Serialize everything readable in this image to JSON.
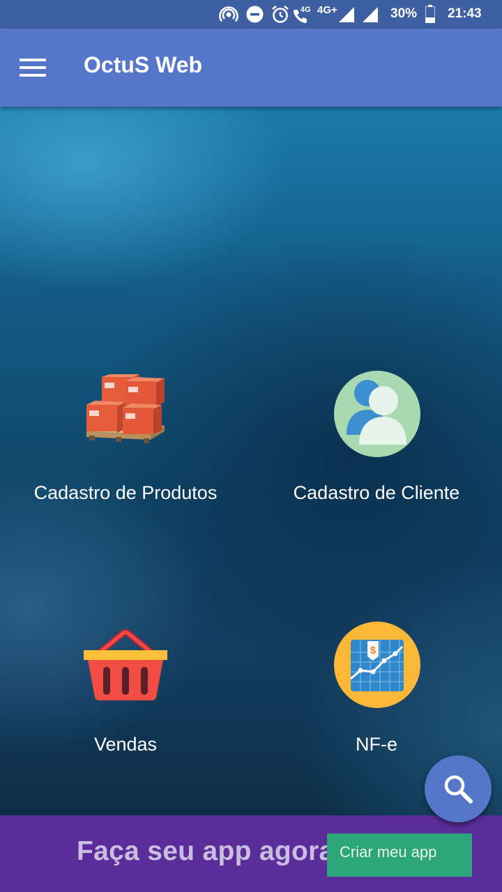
{
  "status_bar": {
    "network_label": "4G",
    "network_type": "4G+",
    "battery": "30%",
    "time": "21:43",
    "icons": [
      "hotspot-icon",
      "dnd-icon",
      "alarm-icon",
      "volte-call-icon",
      "signal-icon",
      "signal-icon",
      "battery-icon"
    ]
  },
  "app_bar": {
    "title": "OctuS Web",
    "menu_icon": "hamburger-menu-icon"
  },
  "tiles": [
    {
      "label": "Cadastro de Produtos",
      "icon": "pallet-boxes-icon"
    },
    {
      "label": "Cadastro de Cliente",
      "icon": "users-icon"
    },
    {
      "label": "Vendas",
      "icon": "shopping-basket-icon"
    },
    {
      "label": "NF-e",
      "icon": "sales-chart-icon"
    }
  ],
  "fab": {
    "icon": "search-icon"
  },
  "banner": {
    "text": "Faça seu app agora!",
    "button_label": "Criar meu app"
  },
  "colors": {
    "status_bar": "#3f5fa3",
    "app_bar": "#5576c9",
    "banner": "#5b2d9a",
    "banner_button": "#2da57a",
    "fab": "#5576c9"
  }
}
